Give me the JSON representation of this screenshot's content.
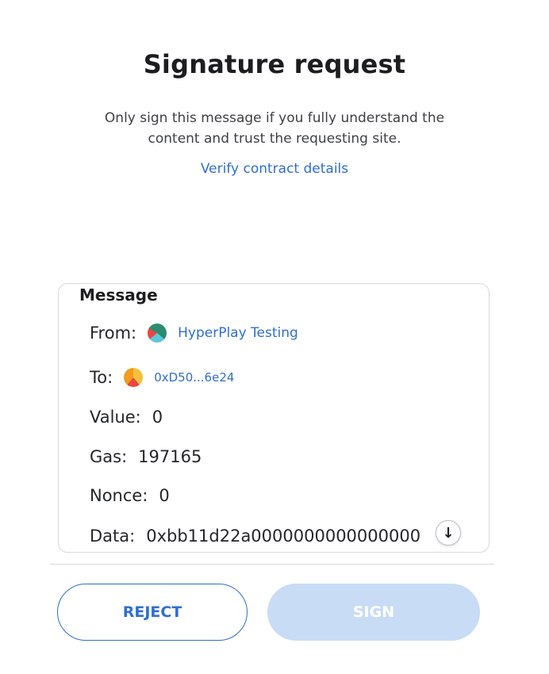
{
  "header": {
    "title": "Signature request",
    "subtitle": "Only sign this message if you fully understand the content and trust the requesting site.",
    "verify_link": "Verify contract details"
  },
  "message": {
    "heading": "Message",
    "from_label": "From:",
    "from_value": "HyperPlay Testing",
    "to_label": "To:",
    "to_value": "0xD50...6e24",
    "value_label": "Value:",
    "value_value": "0",
    "gas_label": "Gas:",
    "gas_value": "197165",
    "nonce_label": "Nonce:",
    "nonce_value": "0",
    "data_label": "Data:",
    "data_value": "0xbb11d22a0000000000000000"
  },
  "icons": {
    "scroll_down": "arrow-down-icon",
    "from_avatar": "jazzicon-avatar",
    "to_avatar": "jazzicon-avatar"
  },
  "actions": {
    "reject_label": "REJECT",
    "sign_label": "SIGN"
  },
  "colors": {
    "link": "#2f6fd0",
    "sign_disabled_bg": "#c9dcf5",
    "border": "#d6d9dc"
  }
}
